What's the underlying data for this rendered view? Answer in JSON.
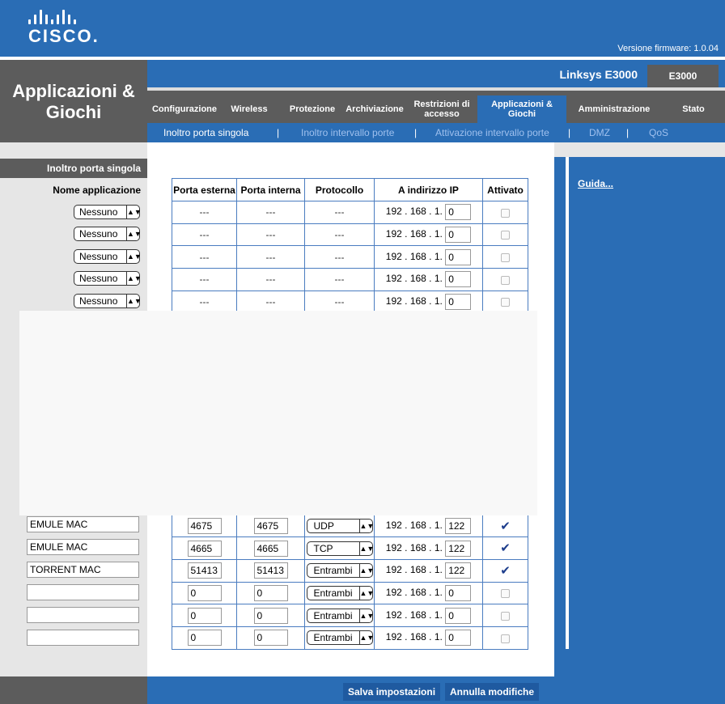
{
  "header": {
    "brand": "CISCO.",
    "firmware": "Versione firmware: 1.0.04"
  },
  "page_title": "Applicazioni & Giochi",
  "product": {
    "name": "Linksys E3000",
    "model": "E3000"
  },
  "nav": {
    "tabs": [
      {
        "label": "Configurazione"
      },
      {
        "label": "Wireless"
      },
      {
        "label": "Protezione"
      },
      {
        "label": "Archiviazione"
      },
      {
        "label": "Restrizioni di accesso"
      },
      {
        "label": "Applicazioni & Giochi"
      },
      {
        "label": "Amministrazione"
      },
      {
        "label": "Stato"
      }
    ],
    "subtabs": [
      {
        "label": "Inoltro porta singola"
      },
      {
        "label": "Inoltro intervallo porte"
      },
      {
        "label": "Attivazione intervallo porte"
      },
      {
        "label": "DMZ"
      },
      {
        "label": "QoS"
      }
    ]
  },
  "sidebar": {
    "heading": "Inoltro porta singola",
    "subheading": "Nome applicazione",
    "preset_rows": [
      {
        "app": "Nessuno"
      },
      {
        "app": "Nessuno"
      },
      {
        "app": "Nessuno"
      },
      {
        "app": "Nessuno"
      },
      {
        "app": "Nessuno"
      }
    ],
    "custom_rows": [
      {
        "name": "EMULE MAC"
      },
      {
        "name": "EMULE MAC"
      },
      {
        "name": "TORRENT MAC"
      },
      {
        "name": ""
      },
      {
        "name": ""
      },
      {
        "name": ""
      }
    ]
  },
  "table": {
    "headers": {
      "external": "Porta esterna",
      "internal": "Porta interna",
      "protocol": "Protocollo",
      "ip": "A indirizzo IP",
      "enabled": "Attivato"
    },
    "ip_prefix": "192 . 168 . 1.",
    "preset_rows": [
      {
        "external": "---",
        "internal": "---",
        "protocol": "---",
        "ip_last": "0",
        "enabled": false
      },
      {
        "external": "---",
        "internal": "---",
        "protocol": "---",
        "ip_last": "0",
        "enabled": false
      },
      {
        "external": "---",
        "internal": "---",
        "protocol": "---",
        "ip_last": "0",
        "enabled": false
      },
      {
        "external": "---",
        "internal": "---",
        "protocol": "---",
        "ip_last": "0",
        "enabled": false
      },
      {
        "external": "---",
        "internal": "---",
        "protocol": "---",
        "ip_last": "0",
        "enabled": false
      }
    ],
    "custom_rows": [
      {
        "external": "4675",
        "internal": "4675",
        "protocol": "UDP",
        "ip_last": "122",
        "enabled": true
      },
      {
        "external": "4665",
        "internal": "4665",
        "protocol": "TCP",
        "ip_last": "122",
        "enabled": true
      },
      {
        "external": "51413",
        "internal": "51413",
        "protocol": "Entrambi",
        "ip_last": "122",
        "enabled": true
      },
      {
        "external": "0",
        "internal": "0",
        "protocol": "Entrambi",
        "ip_last": "0",
        "enabled": false
      },
      {
        "external": "0",
        "internal": "0",
        "protocol": "Entrambi",
        "ip_last": "0",
        "enabled": false
      },
      {
        "external": "0",
        "internal": "0",
        "protocol": "Entrambi",
        "ip_last": "0",
        "enabled": false
      }
    ]
  },
  "help": {
    "link": "Guida..."
  },
  "actions": {
    "save": "Salva impostazioni",
    "cancel": "Annulla modifiche"
  },
  "colors": {
    "brand_blue": "#2a6db5",
    "dark_gray": "#5c5c5c",
    "light_gray": "#e6e6e6"
  }
}
